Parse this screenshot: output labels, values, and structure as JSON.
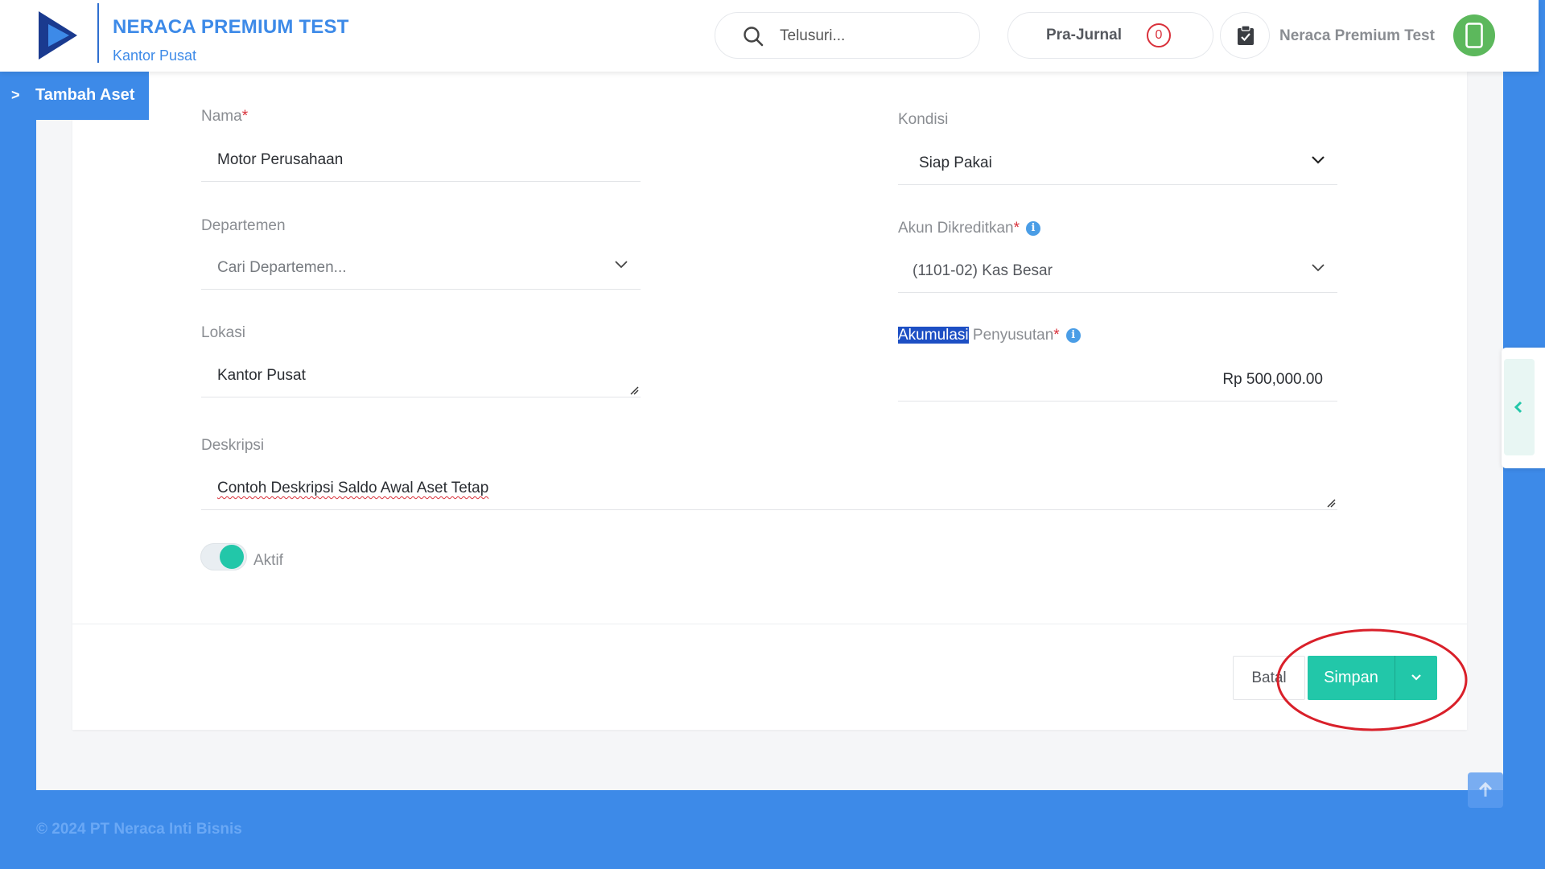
{
  "header": {
    "brand_name": "NERACA PREMIUM TEST",
    "brand_sub": "Kantor Pusat",
    "search_placeholder": "Telusuri...",
    "prajurnal_label": "Pra-Jurnal",
    "prajurnal_count": "0",
    "user_name": "Neraca Premium Test"
  },
  "breadcrumb": {
    "label": "Tambah Aset"
  },
  "form": {
    "nama": {
      "label": "Nama",
      "value": "Motor Perusahaan"
    },
    "kondisi": {
      "label": "Kondisi",
      "value": "Siap Pakai"
    },
    "departemen": {
      "label": "Departemen",
      "placeholder": "Cari Departemen..."
    },
    "akun_dikreditkan": {
      "label": "Akun Dikreditkan",
      "value": "(1101-02) Kas Besar"
    },
    "lokasi": {
      "label": "Lokasi",
      "value": "Kantor Pusat"
    },
    "akumulasi_penyusutan": {
      "label_highlight": "Akumulasi",
      "label_rest": " Penyusutan",
      "value": "Rp 500,000.00"
    },
    "deskripsi": {
      "label": "Deskripsi",
      "value": "Contoh Deskripsi Saldo Awal Aset Tetap"
    },
    "aktif": {
      "label": "Aktif",
      "checked": true
    }
  },
  "actions": {
    "batal": "Batal",
    "simpan": "Simpan"
  },
  "footer": {
    "copyright": "© 2024 PT Neraca Inti Bisnis"
  },
  "colors": {
    "brand": "#3d8ae8",
    "accent": "#22c7a9",
    "required": "#d9303a",
    "annotation": "#d9202a"
  },
  "icons": [
    "logo-icon",
    "search-icon",
    "clipboard-check-icon",
    "mobile-icon",
    "chevron-right-icon",
    "chevron-down-icon",
    "info-icon",
    "chevron-left-icon",
    "arrow-up-icon"
  ]
}
